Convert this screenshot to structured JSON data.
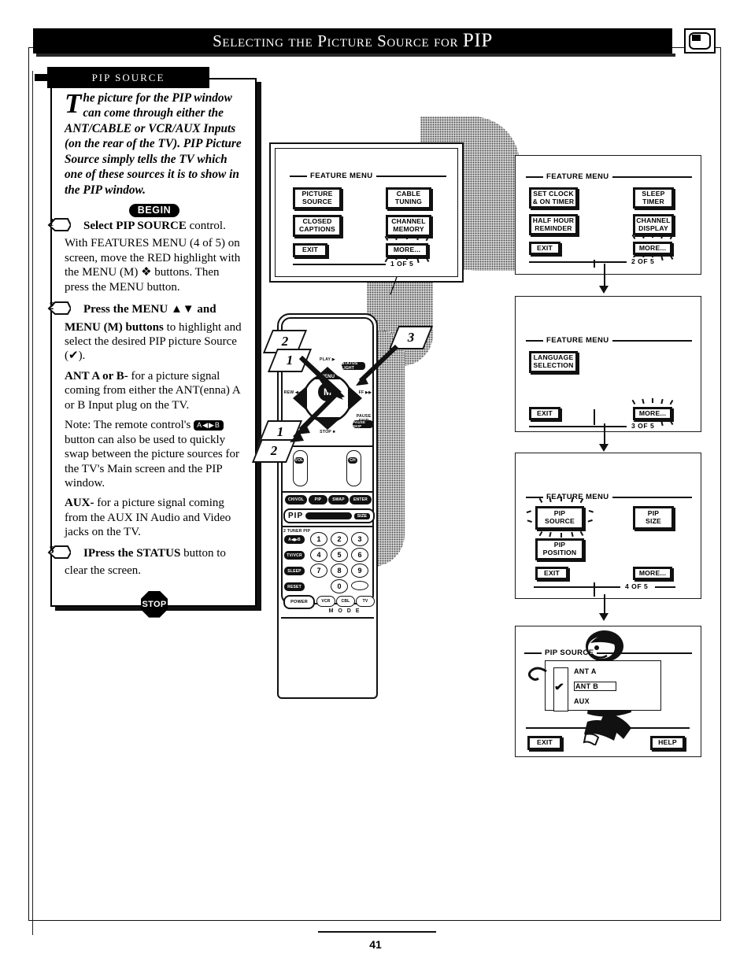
{
  "page": {
    "title_small_caps": "Selecting the Picture Source for",
    "title_emphasis": "PIP",
    "number": "41",
    "corner_icon": "pip-tv-icon"
  },
  "section": {
    "tab_label": "PIP SOURCE"
  },
  "instructions": {
    "intro_dropcap": "T",
    "intro_text": "he picture for the PIP window can come through either the ANT/CABLE or VCR/AUX Inputs (on the rear of the TV). PIP Picture Source simply tells the TV which one of these sources it is to show in the PIP window.",
    "begin_badge": "BEGIN",
    "steps": [
      {
        "number": "1",
        "heading_bold": "Select PIP SOURCE",
        "heading_rest": " control.",
        "body": "With FEATURES MENU (4 of 5) on screen, move the RED highlight with the MENU (M) ❖ buttons. Then press the MENU button."
      },
      {
        "number": "2",
        "heading_bold": "Press the MENU ▲▼ and",
        "heading_rest": "",
        "body_lead": "MENU (M) buttons",
        "body": " to highlight and select the desired PIP picture Source (✔).",
        "para_ant_bold": "ANT A or B-",
        "para_ant": " for a picture signal coming from either the ANT(enna) A or B Input plug on the TV.",
        "para_note_pre": "Note: The remote control's ",
        "para_note_glyph": "A◀▶B",
        "para_note_post": " button can also be used to quickly swap between the picture sources for the TV's Main screen and the PIP window.",
        "para_aux_bold": "AUX-",
        "para_aux": " for a picture signal coming from the AUX IN Audio and Video jacks on the TV."
      },
      {
        "number": "3",
        "heading_bold": "IPress the STATUS",
        "heading_rest": " button to",
        "body": "clear the screen."
      }
    ],
    "stop_badge": "STOP"
  },
  "menus": [
    {
      "id": "feature-menu-1",
      "title": "FEATURE MENU",
      "page_label": "1 OF 5",
      "buttons": [
        {
          "lines": [
            "PICTURE",
            "SOURCE"
          ],
          "highlighted": false
        },
        {
          "lines": [
            "CABLE",
            "TUNING"
          ],
          "highlighted": false
        },
        {
          "lines": [
            "CLOSED",
            "CAPTIONS"
          ],
          "highlighted": false
        },
        {
          "lines": [
            "CHANNEL",
            "MEMORY"
          ],
          "highlighted": false
        },
        {
          "lines": [
            "EXIT"
          ],
          "highlighted": false
        },
        {
          "lines": [
            "MORE..."
          ],
          "highlighted": true
        }
      ]
    },
    {
      "id": "feature-menu-2",
      "title": "FEATURE MENU",
      "page_label": "2 OF 5",
      "buttons": [
        {
          "lines": [
            "SET CLOCK",
            "& ON TIMER"
          ],
          "highlighted": false
        },
        {
          "lines": [
            "SLEEP",
            "TIMER"
          ],
          "highlighted": false
        },
        {
          "lines": [
            "HALF HOUR",
            "REMINDER"
          ],
          "highlighted": false
        },
        {
          "lines": [
            "CHANNEL",
            "DISPLAY"
          ],
          "highlighted": false
        },
        {
          "lines": [
            "EXIT"
          ],
          "highlighted": false
        },
        {
          "lines": [
            "MORE..."
          ],
          "highlighted": true
        }
      ]
    },
    {
      "id": "feature-menu-3",
      "title": "FEATURE MENU",
      "page_label": "3 OF 5",
      "buttons": [
        {
          "lines": [
            "LANGUAGE",
            "SELECTION"
          ],
          "highlighted": false
        },
        {
          "lines": [
            "EXIT"
          ],
          "highlighted": false
        },
        {
          "lines": [
            "MORE..."
          ],
          "highlighted": true
        }
      ]
    },
    {
      "id": "feature-menu-4",
      "title": "FEATURE MENU",
      "page_label": "4 OF 5",
      "buttons": [
        {
          "lines": [
            "PIP",
            "SOURCE"
          ],
          "highlighted": true
        },
        {
          "lines": [
            "PIP",
            "SIZE"
          ],
          "highlighted": false
        },
        {
          "lines": [
            "PIP",
            "POSITION"
          ],
          "highlighted": false
        },
        {
          "lines": [
            "EXIT"
          ],
          "highlighted": false
        },
        {
          "lines": [
            "MORE..."
          ],
          "highlighted": false
        }
      ]
    }
  ],
  "pip_source_screen": {
    "title": "PIP SOURCE",
    "options": [
      {
        "label": "ANT A",
        "selected": false
      },
      {
        "label": "ANT B",
        "selected": true
      },
      {
        "label": "AUX",
        "selected": false
      }
    ],
    "check_glyph": "✔",
    "exit_label": "EXIT",
    "help_label": "HELP"
  },
  "remote": {
    "callouts": [
      "1",
      "2",
      "3",
      "1",
      "2"
    ],
    "labels": {
      "play": "PLAY ▶",
      "status_light": "STATUS LIGHT",
      "menu_m": "M",
      "menu_word": "MENU",
      "rew": "REW ◀◀",
      "ff": "FF ▶▶",
      "pause_skip": "PAUSE SKIP",
      "stop": "STOP ■",
      "vol": "VOL",
      "ch": "CH",
      "pip": "PIP",
      "pip_size": "SIZE",
      "two_tuner_pip": "2 TUNER PIP",
      "swap": "A◀▶B",
      "tv_vcr": "TV/VCR",
      "sleep": "SLEEP",
      "reset": "RESET",
      "power": "POWER",
      "mode_word": "M O D E",
      "modes": [
        "VCR",
        "CBL",
        "TV"
      ],
      "row_keys": [
        "CH/VOL",
        "PIP",
        "SWAP",
        "ENTER"
      ],
      "keypad": [
        "1",
        "2",
        "3",
        "4",
        "5",
        "6",
        "7",
        "8",
        "9",
        "0"
      ]
    }
  }
}
